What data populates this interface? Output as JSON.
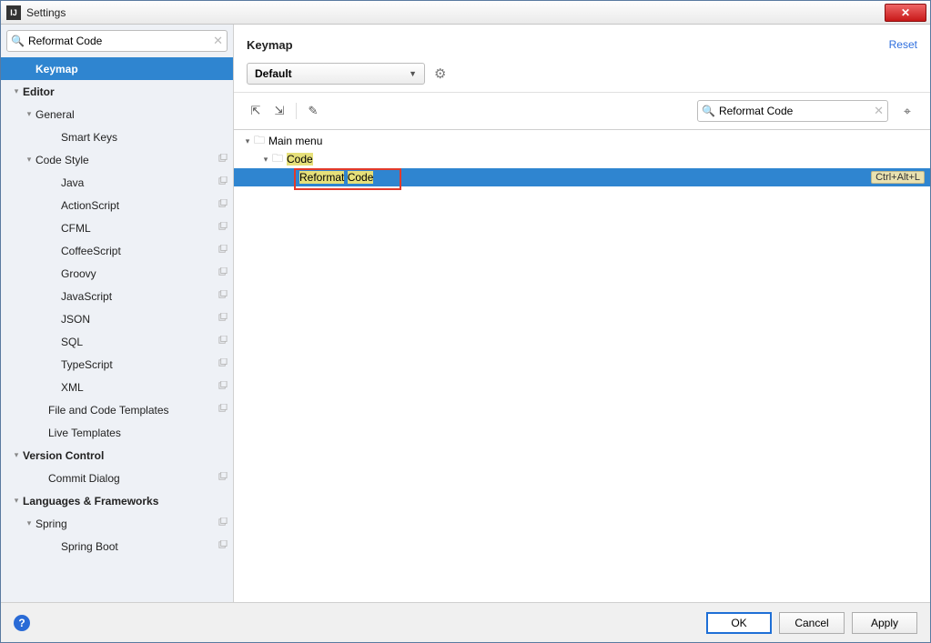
{
  "window": {
    "title": "Settings",
    "close_glyph": "✕"
  },
  "sidebar": {
    "search_value": "Reformat Code",
    "clear_glyph": "✕",
    "mag_glyph": "🔍",
    "items": [
      {
        "label": "Keymap",
        "indent": 1,
        "bold": true,
        "selected": true,
        "arrow": ""
      },
      {
        "label": "Editor",
        "indent": 0,
        "bold": true,
        "arrow": "▾"
      },
      {
        "label": "General",
        "indent": 1,
        "arrow": "▾"
      },
      {
        "label": "Smart Keys",
        "indent": 3
      },
      {
        "label": "Code Style",
        "indent": 1,
        "arrow": "▾",
        "copy": true
      },
      {
        "label": "Java",
        "indent": 3,
        "copy": true
      },
      {
        "label": "ActionScript",
        "indent": 3,
        "copy": true
      },
      {
        "label": "CFML",
        "indent": 3,
        "copy": true
      },
      {
        "label": "CoffeeScript",
        "indent": 3,
        "copy": true
      },
      {
        "label": "Groovy",
        "indent": 3,
        "copy": true
      },
      {
        "label": "JavaScript",
        "indent": 3,
        "copy": true
      },
      {
        "label": "JSON",
        "indent": 3,
        "copy": true
      },
      {
        "label": "SQL",
        "indent": 3,
        "copy": true
      },
      {
        "label": "TypeScript",
        "indent": 3,
        "copy": true
      },
      {
        "label": "XML",
        "indent": 3,
        "copy": true
      },
      {
        "label": "File and Code Templates",
        "indent": 2,
        "copy": true
      },
      {
        "label": "Live Templates",
        "indent": 2
      },
      {
        "label": "Version Control",
        "indent": 0,
        "bold": true,
        "arrow": "▾"
      },
      {
        "label": "Commit Dialog",
        "indent": 2,
        "copy": true
      },
      {
        "label": "Languages & Frameworks",
        "indent": 0,
        "bold": true,
        "arrow": "▾"
      },
      {
        "label": "Spring",
        "indent": 1,
        "arrow": "▾",
        "copy": true
      },
      {
        "label": "Spring Boot",
        "indent": 3,
        "copy": true
      }
    ]
  },
  "main": {
    "title": "Keymap",
    "reset": "Reset",
    "scheme": "Default",
    "gear_glyph": "⚙",
    "expand_glyph": "⇱",
    "collapse_glyph": "⇲",
    "edit_glyph": "✎",
    "search_value": "Reformat Code",
    "clear_glyph": "✕",
    "mag_glyph": "🔍",
    "findaction_glyph": "⌖",
    "tree": {
      "mainmenu": "Main menu",
      "code": "Code",
      "reformat_word1": "Reformat",
      "reformat_word2": "Code",
      "shortcut": "Ctrl+Alt+L"
    }
  },
  "footer": {
    "help_glyph": "?",
    "ok": "OK",
    "cancel": "Cancel",
    "apply": "Apply"
  }
}
